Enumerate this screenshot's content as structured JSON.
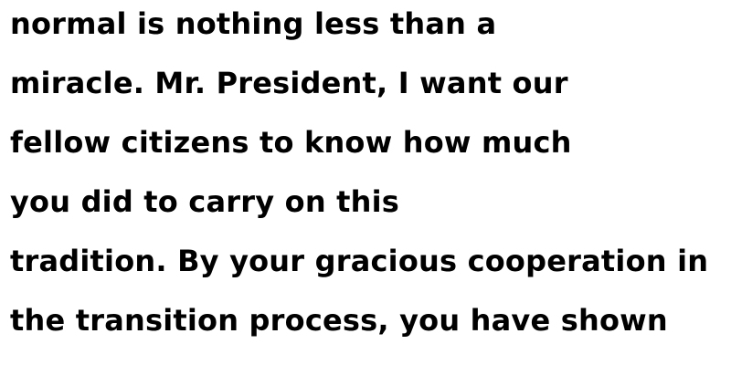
{
  "document": {
    "lines": [
      "normal is nothing less than a",
      "miracle. Mr. President, I want our",
      "fellow citizens to know how much",
      "you did to carry on this",
      "tradition. By your gracious cooperation in",
      "the transition process, you have shown"
    ]
  }
}
